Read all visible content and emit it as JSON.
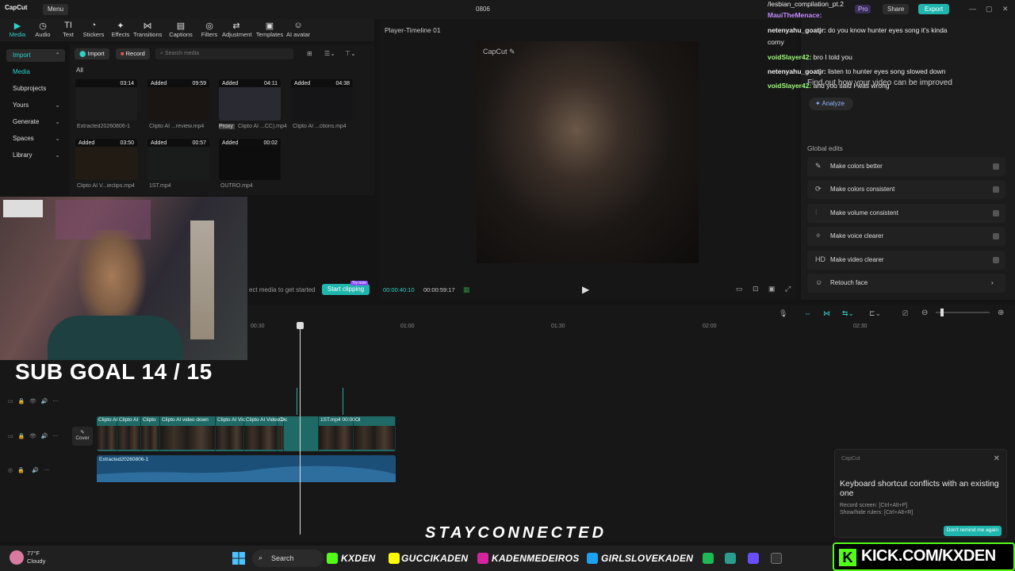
{
  "app": {
    "logo": "CapCut",
    "menu": "Menu",
    "project_title": "0806",
    "pro_badge": "Pro",
    "share": "Share",
    "export": "Export",
    "window_controls": [
      "—",
      "▢",
      "✕"
    ]
  },
  "toolbar": [
    {
      "label": "Media",
      "icon": "media-icon",
      "glyph": "▶"
    },
    {
      "label": "Audio",
      "icon": "audio-icon",
      "glyph": "◷"
    },
    {
      "label": "Text",
      "icon": "text-icon",
      "glyph": "TI"
    },
    {
      "label": "Stickers",
      "icon": "stickers-icon",
      "glyph": "◔"
    },
    {
      "label": "Effects",
      "icon": "effects-icon",
      "glyph": "✦"
    },
    {
      "label": "Transitions",
      "icon": "transitions-icon",
      "glyph": "⋈"
    },
    {
      "label": "Captions",
      "icon": "captions-icon",
      "glyph": "▤"
    },
    {
      "label": "Filters",
      "icon": "filters-icon",
      "glyph": "◎"
    },
    {
      "label": "Adjustment",
      "icon": "adjustment-icon",
      "glyph": "⇄"
    },
    {
      "label": "Templates",
      "icon": "templates-icon",
      "glyph": "▣"
    },
    {
      "label": "AI avatar",
      "icon": "ai-avatar-icon",
      "glyph": "☺"
    }
  ],
  "leftnav": [
    "Import",
    "Media",
    "Subprojects",
    "Yours",
    "Generate",
    "Spaces",
    "Library"
  ],
  "media": {
    "import": "Import",
    "record": "Record",
    "search_placeholder": "Search media",
    "filter_all": "All",
    "items": [
      {
        "badge": "",
        "duration": "03:14",
        "name": "Extracted20260806-1"
      },
      {
        "badge": "Added",
        "duration": "09:59",
        "name": "Clipto AI ...review.mp4"
      },
      {
        "badge": "Added",
        "duration": "04:11",
        "name": "Clipto AI ...CC).mp4",
        "proxy": "Proxy"
      },
      {
        "badge": "Added",
        "duration": "04:38",
        "name": "Clipto AI ...ctions.mp4"
      },
      {
        "badge": "Added",
        "duration": "03:50",
        "name": "Clipto AI V...ieclips.mp4"
      },
      {
        "badge": "Added",
        "duration": "00:57",
        "name": "1ST.mp4"
      },
      {
        "badge": "Added",
        "duration": "00:02",
        "name": "OUTRO.mp4"
      }
    ],
    "get_started": "ect media to get started",
    "start_clipping": "Start clipping",
    "try_now": "Try now"
  },
  "player": {
    "title": "Player-Timeline 01",
    "watermark": "CapCut",
    "current_time": "00:00:40:10",
    "total_time": "00:00:59:17"
  },
  "right_panel": {
    "hint": "Find out how your video can be improved",
    "analyze": "Analyze",
    "global_edits": "Global edits",
    "edits": [
      {
        "label": "Make colors better",
        "icon": "colors-icon",
        "glyph": "✎"
      },
      {
        "label": "Make colors consistent",
        "icon": "consistent-icon",
        "glyph": "⟳"
      },
      {
        "label": "Make volume consistent",
        "icon": "volume-icon",
        "glyph": "⫶"
      },
      {
        "label": "Make voice clearer",
        "icon": "voice-icon",
        "glyph": "✧"
      },
      {
        "label": "Make video clearer",
        "icon": "hd-icon",
        "glyph": "HD"
      },
      {
        "label": "Retouch face",
        "icon": "face-icon",
        "glyph": "☺"
      }
    ]
  },
  "chat": [
    {
      "name": "",
      "msg": "/lesbian_compilation_pt.2",
      "color": "#ddd"
    },
    {
      "name": "MauiTheMenace:",
      "msg": "",
      "color": "#c38cff"
    },
    {
      "name": "netenyahu_goatjr:",
      "msg": "do you know hunter eyes song it's kinda",
      "color": "#eee"
    },
    {
      "name": "",
      "msg": "corny",
      "color": "#eee"
    },
    {
      "name": "voidSlayer42:",
      "msg": "bro I told you",
      "color": "#9cff7a"
    },
    {
      "name": "netenyahu_goatjr:",
      "msg": "listen to hunter eyes song slowed down",
      "color": "#eee"
    },
    {
      "name": "voidSlayer42:",
      "msg": "and you said I was wrong",
      "color": "#9cff7a"
    }
  ],
  "timeline": {
    "ruler": [
      "00:30",
      "01:00",
      "01:30",
      "02:00",
      "02:30"
    ],
    "clips": [
      "Clipto AI",
      "Clipto AI",
      "Clipto",
      "Clipto AI video down",
      "Clipto AI Vic",
      "Clipto AI Video Dc",
      "Cl",
      "",
      "1ST.mp4  00:00",
      "Ol"
    ],
    "audio_label": "Extracted20260806-1",
    "cover": "Cover"
  },
  "toast": {
    "app": "CapCut",
    "title": "Keyboard shortcut conflicts with an existing one",
    "line1": "Record screen: [Ctrl+Alt+P]",
    "line2": "Show/hide rulers: [Ctrl+Alt+R]",
    "button": "Don't remind me again"
  },
  "overlay": {
    "sub_goal": "SUB GOAL 14 / 15",
    "stay_connected": "STAYCONNECTED",
    "kick_url": "KICK.COM/KXDEN"
  },
  "taskbar": {
    "temp": "77°F",
    "condition": "Cloudy",
    "search": "Search",
    "socials": [
      "KXDEN",
      "GUCCIKADEN",
      "KADENMEDEIROS",
      "GIRLSLOVEKADEN"
    ]
  }
}
